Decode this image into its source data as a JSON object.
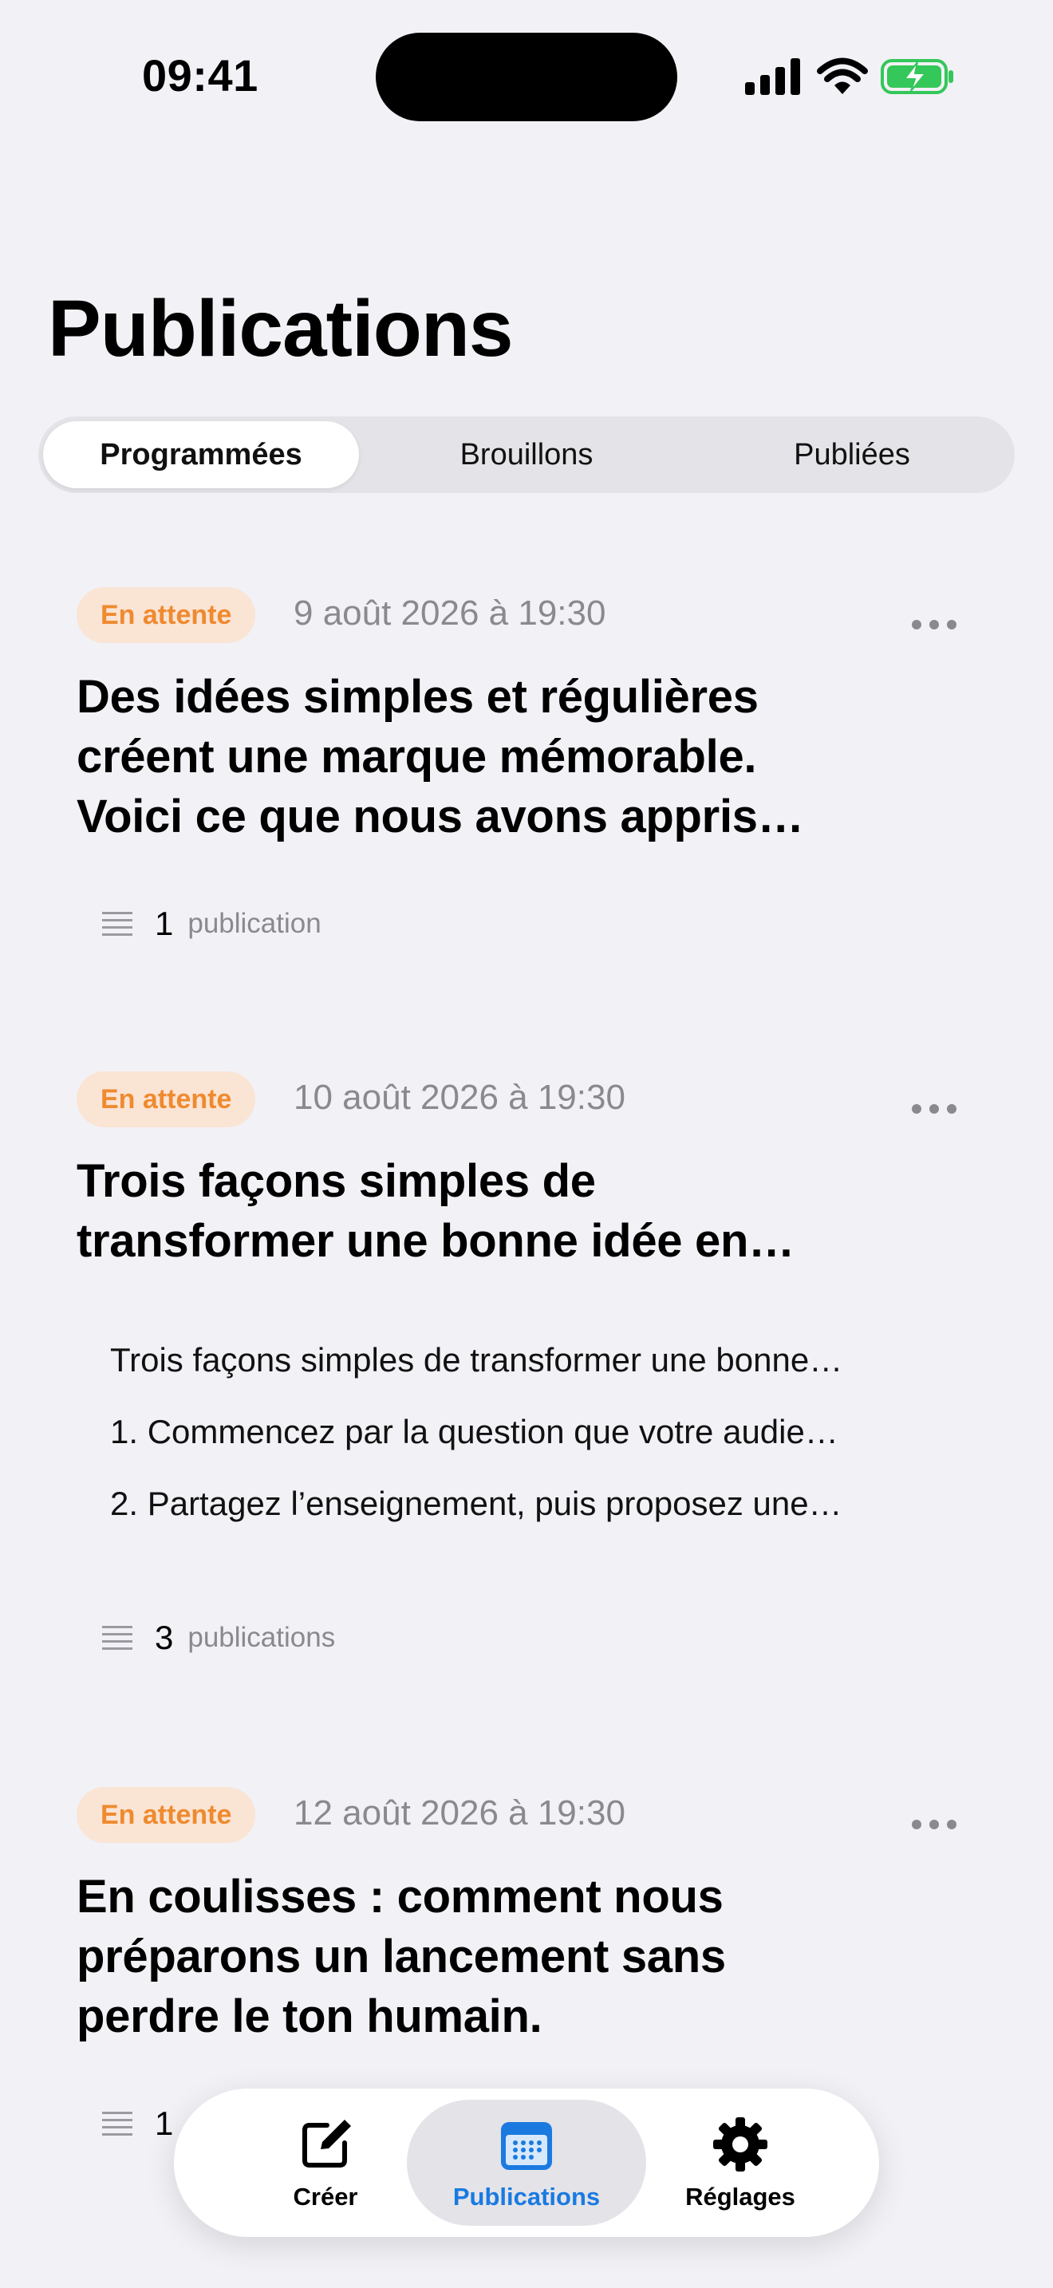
{
  "status_bar": {
    "time": "09:41"
  },
  "header": {
    "title": "Publications"
  },
  "segments": [
    {
      "label": "Programmées",
      "active": true
    },
    {
      "label": "Brouillons",
      "active": false
    },
    {
      "label": "Publiées",
      "active": false
    }
  ],
  "posts": [
    {
      "status": "En attente",
      "date": "9 août 2026 à 19:30",
      "title_lines": [
        "Des idées simples et régulières",
        "créent une marque mémorable.",
        "Voici ce que nous avons appris…"
      ],
      "preview": [],
      "count": "1",
      "count_label": "publication"
    },
    {
      "status": "En attente",
      "date": "10 août 2026 à 19:30",
      "title_lines": [
        "Trois façons simples de",
        "transformer une bonne idée en…"
      ],
      "preview": [
        "Trois façons simples de transformer une bonne…",
        "1. Commencez par la question que votre audie…",
        "2. Partagez l’enseignement, puis proposez une…"
      ],
      "count": "3",
      "count_label": "publications"
    },
    {
      "status": "En attente",
      "date": "12 août 2026 à 19:30",
      "title_lines": [
        "En coulisses : comment nous",
        "préparons un lancement sans",
        "perdre le ton humain."
      ],
      "preview": [],
      "count": "1",
      "count_label": ""
    }
  ],
  "tabbar": {
    "items": [
      {
        "label": "Créer",
        "icon": "compose-icon",
        "active": false
      },
      {
        "label": "Publications",
        "icon": "calendar-icon",
        "active": true
      },
      {
        "label": "Réglages",
        "icon": "gear-icon",
        "active": false
      }
    ]
  },
  "colors": {
    "background": "#f2f1f6",
    "badge_bg": "#fae4d4",
    "badge_text": "#ef8a2f",
    "accent": "#1a7ae0",
    "battery": "#34c759"
  }
}
